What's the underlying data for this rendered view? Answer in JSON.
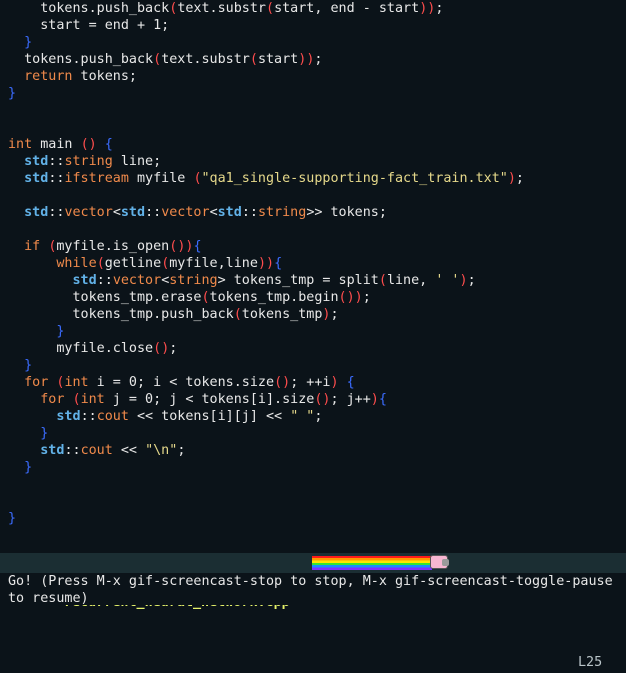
{
  "code_lines": [
    "    tokens.push_back(text.substr(start, end - start));",
    "    start = end + 1;",
    "  }",
    "  tokens.push_back(text.substr(start));",
    "  return tokens;",
    "}",
    "",
    "",
    "int main () {",
    "  std::string line;",
    "  std::ifstream myfile (\"qa1_single-supporting-fact_train.txt\");",
    "",
    "  std::vector<std::vector<std::string>> tokens;",
    "",
    "  if (myfile.is_open()){",
    "      while(getline(myfile,line)){",
    "        std::vector<string> tokens_tmp = split(line, ' ');",
    "        tokens_tmp.erase(tokens_tmp.begin());",
    "        tokens_tmp.push_back(tokens_tmp);",
    "      }",
    "      myfile.close();",
    "  }",
    "  for (int i = 0; i < tokens.size(); ++i) {",
    "    for (int j = 0; j < tokens[i].size(); j++){",
    "      std::cout << tokens[i][j] << \" \";",
    "    }",
    "    std::cout << \"\\n\";",
    "  }",
    "",
    "",
    "}"
  ],
  "modeline": {
    "state": "-:**-",
    "buffer_name": "recurrent_neural_network.cpp",
    "line_indicator": "L25"
  },
  "echo_area": {
    "line1": "Go! (Press M-x gif-screencast-stop to stop, M-x gif-screencast-toggle-pause",
    "line2": "to resume)"
  },
  "colors": {
    "background": "#0b1319",
    "modeline_bg": "#1b2e33",
    "keyword": "#f08a4b",
    "namespace": "#62b2e8",
    "string": "#e6d98b",
    "buffer_name": "#e7f36b"
  }
}
